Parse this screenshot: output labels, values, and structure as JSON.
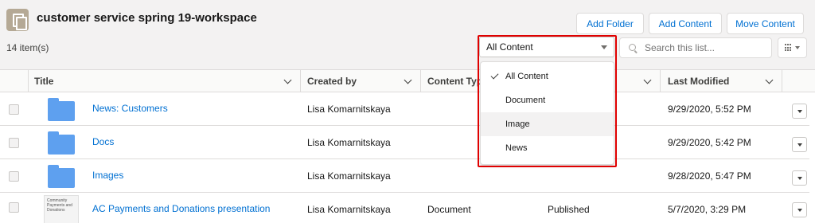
{
  "header": {
    "title": "customer service spring 19-workspace",
    "item_count": "14 item(s)",
    "buttons": {
      "add_folder": "Add Folder",
      "add_content": "Add Content",
      "move_content": "Move Content"
    }
  },
  "filter": {
    "selected": "All Content",
    "options": [
      {
        "label": "All Content",
        "checked": true
      },
      {
        "label": "Document",
        "checked": false
      },
      {
        "label": "Image",
        "checked": false
      },
      {
        "label": "News",
        "checked": false
      }
    ]
  },
  "search": {
    "placeholder": "Search this list..."
  },
  "table": {
    "columns": [
      "Title",
      "Created by",
      "Content Typ",
      "Last Modified"
    ],
    "rows": [
      {
        "title": "News: Customers",
        "created_by": "Lisa Komarnitskaya",
        "content_type": "",
        "status": "",
        "last_modified": "9/29/2020, 5:52 PM",
        "icon": "folder-icon"
      },
      {
        "title": "Docs",
        "created_by": "Lisa Komarnitskaya",
        "content_type": "",
        "status": "",
        "last_modified": "9/29/2020, 5:42 PM",
        "icon": "folder-icon"
      },
      {
        "title": "Images",
        "created_by": "Lisa Komarnitskaya",
        "content_type": "",
        "status": "",
        "last_modified": "9/28/2020, 5:47 PM",
        "icon": "folder-icon"
      },
      {
        "title": "AC Payments and Donations presentation",
        "created_by": "Lisa Komarnitskaya",
        "content_type": "Document",
        "status": "Published",
        "last_modified": "5/7/2020, 3:29 PM",
        "icon": "document-thumbnail",
        "thumbnail_text": "Community Payments and Donations"
      }
    ]
  },
  "colors": {
    "link": "#0070d2",
    "folder": "#5ea0ef",
    "highlight": "#e00000",
    "header_bg": "#f3f2f2"
  }
}
